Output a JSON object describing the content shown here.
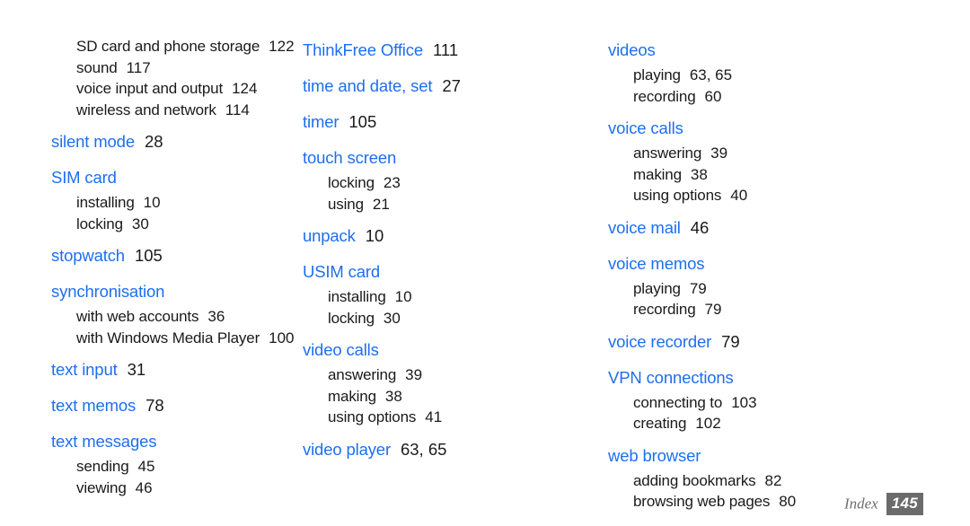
{
  "document": {
    "type": "index-page",
    "heading_color": "#1d6ff0",
    "body_color": "#1a1a1a",
    "page_badge_color": "#6b6b6b"
  },
  "footer": {
    "label": "Index",
    "page_number": "145"
  },
  "columns": [
    {
      "id": "column-1",
      "groups": [
        {
          "heading": null,
          "sub_entries": [
            {
              "label": "SD card and phone storage",
              "ref": "122"
            },
            {
              "label": "sound",
              "ref": "117"
            },
            {
              "label": "voice input and output",
              "ref": "124"
            },
            {
              "label": "wireless and network",
              "ref": "114"
            }
          ]
        },
        {
          "heading": "silent mode",
          "heading_ref": "28",
          "sub_entries": []
        },
        {
          "heading": "SIM card",
          "heading_ref": null,
          "sub_entries": [
            {
              "label": "installing",
              "ref": "10"
            },
            {
              "label": "locking",
              "ref": "30"
            }
          ]
        },
        {
          "heading": "stopwatch",
          "heading_ref": "105",
          "sub_entries": []
        },
        {
          "heading": "synchronisation",
          "heading_ref": null,
          "sub_entries": [
            {
              "label": "with web accounts",
              "ref": "36"
            },
            {
              "label": "with Windows Media Player",
              "ref": "100"
            }
          ]
        },
        {
          "heading": "text input",
          "heading_ref": "31",
          "sub_entries": []
        },
        {
          "heading": "text memos",
          "heading_ref": "78",
          "sub_entries": []
        },
        {
          "heading": "text messages",
          "heading_ref": null,
          "sub_entries": [
            {
              "label": "sending",
              "ref": "45"
            },
            {
              "label": "viewing",
              "ref": "46"
            }
          ]
        }
      ]
    },
    {
      "id": "column-2",
      "groups": [
        {
          "heading": "ThinkFree Office",
          "heading_ref": "111",
          "sub_entries": []
        },
        {
          "heading": "time and date, set",
          "heading_ref": "27",
          "sub_entries": []
        },
        {
          "heading": "timer",
          "heading_ref": "105",
          "sub_entries": []
        },
        {
          "heading": "touch screen",
          "heading_ref": null,
          "sub_entries": [
            {
              "label": "locking",
              "ref": "23"
            },
            {
              "label": "using",
              "ref": "21"
            }
          ]
        },
        {
          "heading": "unpack",
          "heading_ref": "10",
          "sub_entries": []
        },
        {
          "heading": "USIM card",
          "heading_ref": null,
          "sub_entries": [
            {
              "label": "installing",
              "ref": "10"
            },
            {
              "label": "locking",
              "ref": "30"
            }
          ]
        },
        {
          "heading": "video calls",
          "heading_ref": null,
          "sub_entries": [
            {
              "label": "answering",
              "ref": "39"
            },
            {
              "label": "making",
              "ref": "38"
            },
            {
              "label": "using options",
              "ref": "41"
            }
          ]
        },
        {
          "heading": "video player",
          "heading_ref": "63, 65",
          "sub_entries": []
        }
      ]
    },
    {
      "id": "column-3",
      "groups": [
        {
          "heading": "videos",
          "heading_ref": null,
          "sub_entries": [
            {
              "label": "playing",
              "ref": "63, 65"
            },
            {
              "label": "recording",
              "ref": "60"
            }
          ]
        },
        {
          "heading": "voice calls",
          "heading_ref": null,
          "sub_entries": [
            {
              "label": "answering",
              "ref": "39"
            },
            {
              "label": "making",
              "ref": "38"
            },
            {
              "label": "using options",
              "ref": "40"
            }
          ]
        },
        {
          "heading": "voice mail",
          "heading_ref": "46",
          "sub_entries": []
        },
        {
          "heading": "voice memos",
          "heading_ref": null,
          "sub_entries": [
            {
              "label": "playing",
              "ref": "79"
            },
            {
              "label": "recording",
              "ref": "79"
            }
          ]
        },
        {
          "heading": "voice recorder",
          "heading_ref": "79",
          "sub_entries": []
        },
        {
          "heading": "VPN connections",
          "heading_ref": null,
          "sub_entries": [
            {
              "label": "connecting to",
              "ref": "103"
            },
            {
              "label": "creating",
              "ref": "102"
            }
          ]
        },
        {
          "heading": "web browser",
          "heading_ref": null,
          "sub_entries": [
            {
              "label": "adding bookmarks",
              "ref": "82"
            },
            {
              "label": "browsing web pages",
              "ref": "80"
            }
          ]
        }
      ]
    }
  ]
}
